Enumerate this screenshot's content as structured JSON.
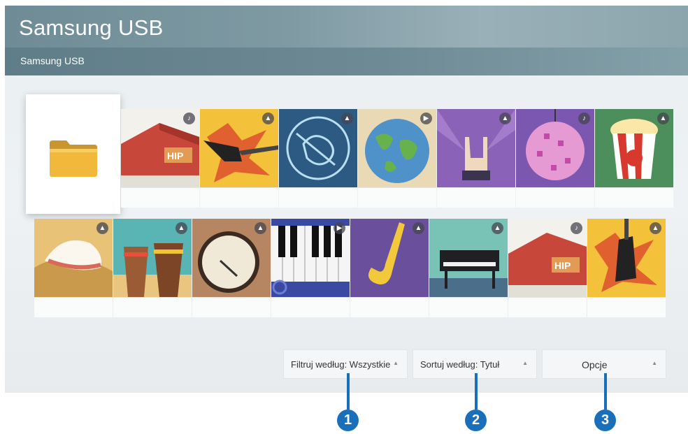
{
  "header": {
    "title": "Samsung USB",
    "breadcrumb": "Samsung USB"
  },
  "folder": {
    "icon": "folder-icon"
  },
  "row1": [
    {
      "name": "tile-red-tent",
      "badge": "music-icon"
    },
    {
      "name": "tile-electric-guitar",
      "badge": "photo-icon"
    },
    {
      "name": "tile-guitar-drawing",
      "badge": "photo-icon"
    },
    {
      "name": "tile-globe",
      "badge": "video-icon"
    },
    {
      "name": "tile-rock-hand",
      "badge": "photo-icon"
    },
    {
      "name": "tile-disco-ball",
      "badge": "music-icon"
    },
    {
      "name": "tile-popcorn",
      "badge": "photo-icon"
    }
  ],
  "row2": [
    {
      "name": "tile-hat",
      "badge": "photo-icon"
    },
    {
      "name": "tile-drums",
      "badge": "photo-icon"
    },
    {
      "name": "tile-banjo",
      "badge": "photo-icon"
    },
    {
      "name": "tile-piano-keys",
      "badge": "video-icon"
    },
    {
      "name": "tile-saxophone",
      "badge": "photo-icon"
    },
    {
      "name": "tile-grand-piano",
      "badge": "photo-icon"
    },
    {
      "name": "tile-red-tent-2",
      "badge": "music-icon"
    },
    {
      "name": "tile-electric-guitar-2",
      "badge": "photo-icon"
    }
  ],
  "controls": {
    "filter_label": "Filtruj według: Wszystkie",
    "sort_label": "Sortuj według: Tytuł",
    "options_label": "Opcje"
  },
  "callouts": [
    "1",
    "2",
    "3"
  ],
  "colors": {
    "callout": "#1a6fba",
    "header": "#6f8c96"
  }
}
